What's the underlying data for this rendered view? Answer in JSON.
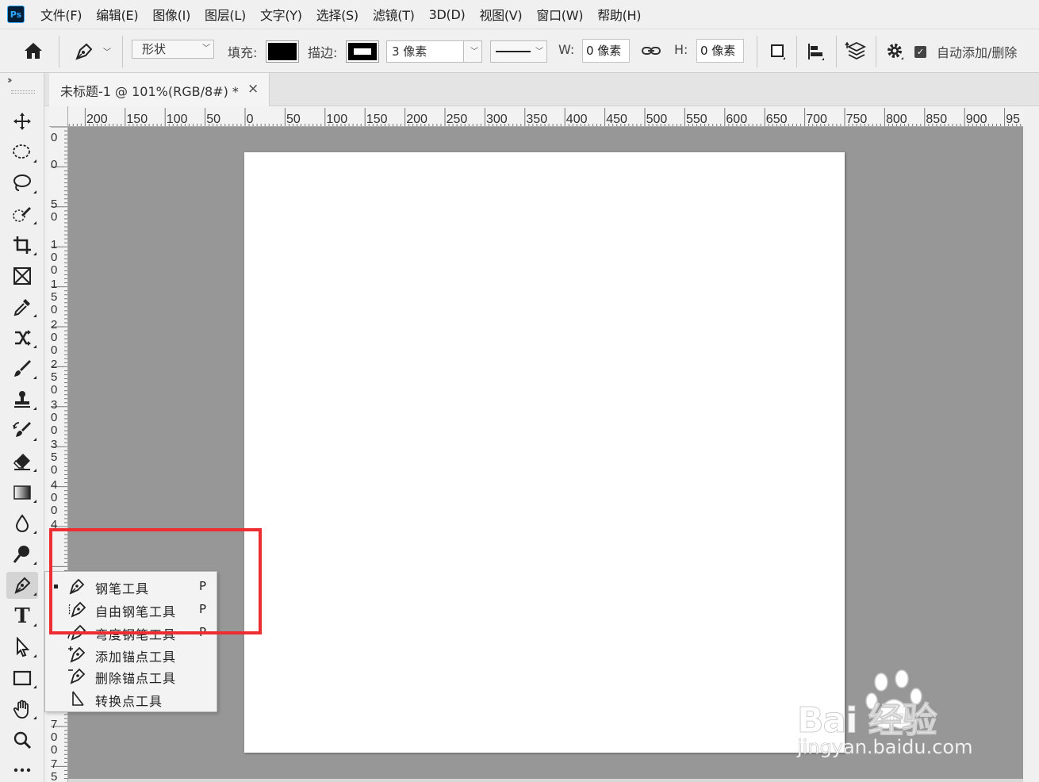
{
  "app": {
    "logo_text": "Ps",
    "accent_color": "#31a8ff",
    "logo_bg": "#001e36"
  },
  "menu": {
    "items": [
      "文件(F)",
      "编辑(E)",
      "图像(I)",
      "图层(L)",
      "文字(Y)",
      "选择(S)",
      "滤镜(T)",
      "3D(D)",
      "视图(V)",
      "窗口(W)",
      "帮助(H)"
    ]
  },
  "options": {
    "mode_value": "形状",
    "fill_label": "填充:",
    "fill_color": "#000000",
    "stroke_label": "描边:",
    "stroke_width": "3 像素",
    "w_label": "W:",
    "w_value": "0 像素",
    "h_label": "H:",
    "h_value": "0 像素",
    "auto_add_delete_label": "自动添加/删除",
    "auto_add_delete_checked": true
  },
  "document": {
    "tab_title": "未标题-1 @ 101%(RGB/8#) *",
    "close_glyph": "×"
  },
  "rulers": {
    "horizontal_labels": [
      "200",
      "150",
      "100",
      "50",
      "0",
      "50",
      "100",
      "150",
      "200",
      "250",
      "300",
      "350",
      "400",
      "450",
      "500",
      "550",
      "600",
      "650",
      "700",
      "750",
      "800",
      "850",
      "900",
      "95"
    ],
    "vertical_labels": [
      "0",
      "0",
      "50",
      "100",
      "150",
      "200",
      "250",
      "300",
      "350",
      "400",
      "4",
      "700",
      "75"
    ]
  },
  "flyout": {
    "items": [
      {
        "label": "钢笔工具",
        "shortcut": "P",
        "icon": "pen-icon",
        "selected": true
      },
      {
        "label": "自由钢笔工具",
        "shortcut": "P",
        "icon": "freeform-pen-icon",
        "selected": false
      },
      {
        "label": "弯度钢笔工具",
        "shortcut": "P",
        "icon": "curvature-pen-icon",
        "selected": false
      },
      {
        "label": "添加锚点工具",
        "shortcut": "",
        "icon": "add-anchor-icon",
        "selected": false
      },
      {
        "label": "删除锚点工具",
        "shortcut": "",
        "icon": "delete-anchor-icon",
        "selected": false
      },
      {
        "label": "转换点工具",
        "shortcut": "",
        "icon": "convert-point-icon",
        "selected": false
      }
    ]
  },
  "highlight_color": "#ee2d32",
  "watermark": {
    "brand": "Bai  经验",
    "url": "jingyan.baidu.com"
  },
  "colors": {
    "workspace": "#979797",
    "canvas": "#ffffff",
    "chrome": "#f0f0f0"
  }
}
